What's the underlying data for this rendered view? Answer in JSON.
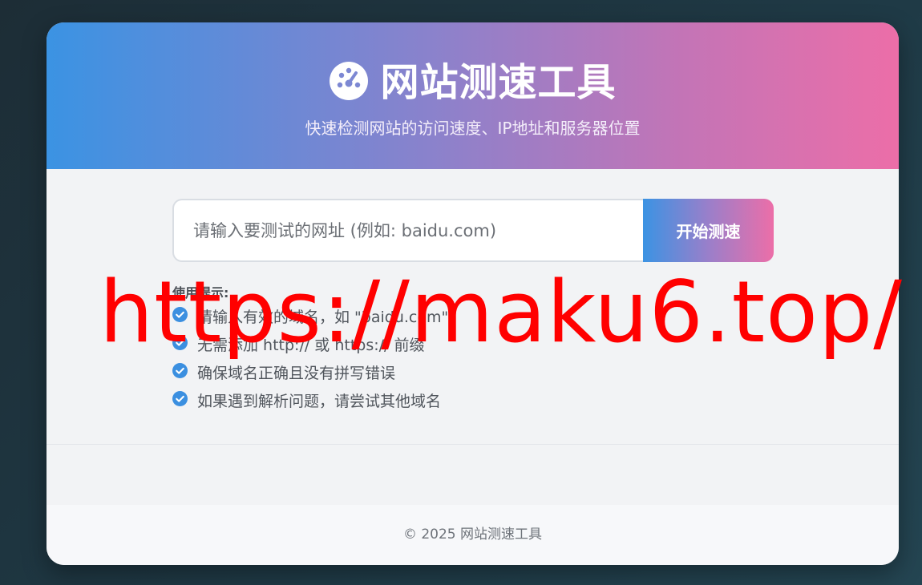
{
  "header": {
    "icon": "speedometer-icon",
    "title": "网站测速工具",
    "subtitle": "快速检测网站的访问速度、IP地址和服务器位置"
  },
  "search": {
    "placeholder": "请输入要测试的网址 (例如: baidu.com)",
    "value": "",
    "button_label": "开始测速"
  },
  "tips": {
    "title": "使用提示:",
    "items": [
      "请输入有效的域名，如 \"baidu.com\"",
      "无需添加 http:// 或 https:// 前缀",
      "确保域名正确且没有拼写错误",
      "如果遇到解析问题，请尝试其他域名"
    ],
    "icon": "check-circle-icon"
  },
  "footer": {
    "text": "© 2025 网站测速工具"
  },
  "watermark": {
    "text": "https://maku6.top/"
  },
  "colors": {
    "gradient_start": "#3b93e3",
    "gradient_end": "#ec6ea8",
    "check": "#3b8fe0",
    "watermark": "#ff0000"
  }
}
